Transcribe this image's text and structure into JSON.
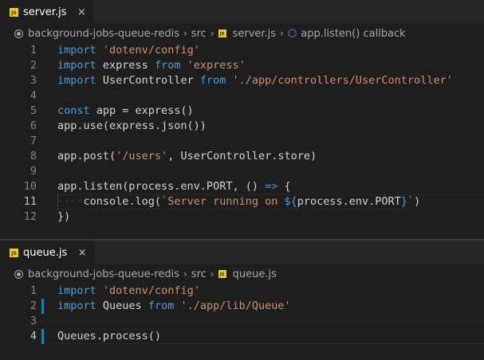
{
  "colors": {
    "editor_bg": "#1e1e1e",
    "keyword": "#569cd6",
    "control_keyword": "#c586c0",
    "string": "#ce9178",
    "text": "#d4d4d4",
    "js_badge": "#e8c83a",
    "modified_gutter": "#1b81a8"
  },
  "pane1": {
    "tab": {
      "icon": "js-file-icon",
      "badge": "JS",
      "label": "server.js",
      "close": "×"
    },
    "breadcrumb": {
      "folder": "background-jobs-queue-redis",
      "sub": "src",
      "file": "server.js",
      "symbol": "app.listen() callback",
      "sep": "›"
    },
    "lines": [
      {
        "n": "1",
        "tokens": [
          [
            "kw",
            "import"
          ],
          [
            "idn",
            " "
          ],
          [
            "str",
            "'dotenv/config'"
          ]
        ]
      },
      {
        "n": "2",
        "tokens": [
          [
            "kw",
            "import"
          ],
          [
            "idn",
            " express "
          ],
          [
            "kw",
            "from"
          ],
          [
            "idn",
            " "
          ],
          [
            "str",
            "'express'"
          ]
        ]
      },
      {
        "n": "3",
        "tokens": [
          [
            "kw",
            "import"
          ],
          [
            "idn",
            " UserController "
          ],
          [
            "kw",
            "from"
          ],
          [
            "idn",
            " "
          ],
          [
            "str",
            "'./app/controllers/UserController'"
          ]
        ]
      },
      {
        "n": "4",
        "tokens": []
      },
      {
        "n": "5",
        "tokens": [
          [
            "kw",
            "const"
          ],
          [
            "idn",
            " app = express()"
          ]
        ]
      },
      {
        "n": "6",
        "tokens": [
          [
            "idn",
            "app.use(express.json())"
          ]
        ]
      },
      {
        "n": "7",
        "tokens": []
      },
      {
        "n": "8",
        "tokens": [
          [
            "idn",
            "app.post("
          ],
          [
            "str",
            "'/users'"
          ],
          [
            "idn",
            ", UserController.store)"
          ]
        ]
      },
      {
        "n": "9",
        "tokens": []
      },
      {
        "n": "10",
        "tokens": [
          [
            "idn",
            "app.listen(process.env.PORT, () "
          ],
          [
            "kw",
            "=>"
          ],
          [
            "idn",
            " {"
          ]
        ]
      },
      {
        "n": "11",
        "tokens": [
          [
            "ws",
            "····"
          ],
          [
            "idn",
            "console.log("
          ],
          [
            "str",
            "`Server running on "
          ],
          [
            "kw",
            "${"
          ],
          [
            "idn",
            "process.env.PORT"
          ],
          [
            "kw",
            "}"
          ],
          [
            "str",
            "`"
          ],
          [
            "idn",
            ")"
          ]
        ],
        "current": true,
        "guide": true
      },
      {
        "n": "12",
        "tokens": [
          [
            "idn",
            "})"
          ]
        ]
      }
    ]
  },
  "pane2": {
    "tab": {
      "icon": "js-file-icon",
      "badge": "JS",
      "label": "queue.js",
      "close": "×"
    },
    "breadcrumb": {
      "folder": "background-jobs-queue-redis",
      "sub": "src",
      "file": "queue.js",
      "sep": "›"
    },
    "lines": [
      {
        "n": "1",
        "tokens": [
          [
            "kw",
            "import"
          ],
          [
            "idn",
            " "
          ],
          [
            "str",
            "'dotenv/config'"
          ]
        ]
      },
      {
        "n": "2",
        "tokens": [
          [
            "kw",
            "import"
          ],
          [
            "idn",
            " Queues "
          ],
          [
            "kw",
            "from"
          ],
          [
            "idn",
            " "
          ],
          [
            "str",
            "'./app/lib/Queue'"
          ]
        ],
        "modified": true
      },
      {
        "n": "3",
        "tokens": []
      },
      {
        "n": "4",
        "tokens": [
          [
            "idn",
            "Queues.process()"
          ]
        ],
        "modified": true,
        "current": true
      }
    ]
  }
}
